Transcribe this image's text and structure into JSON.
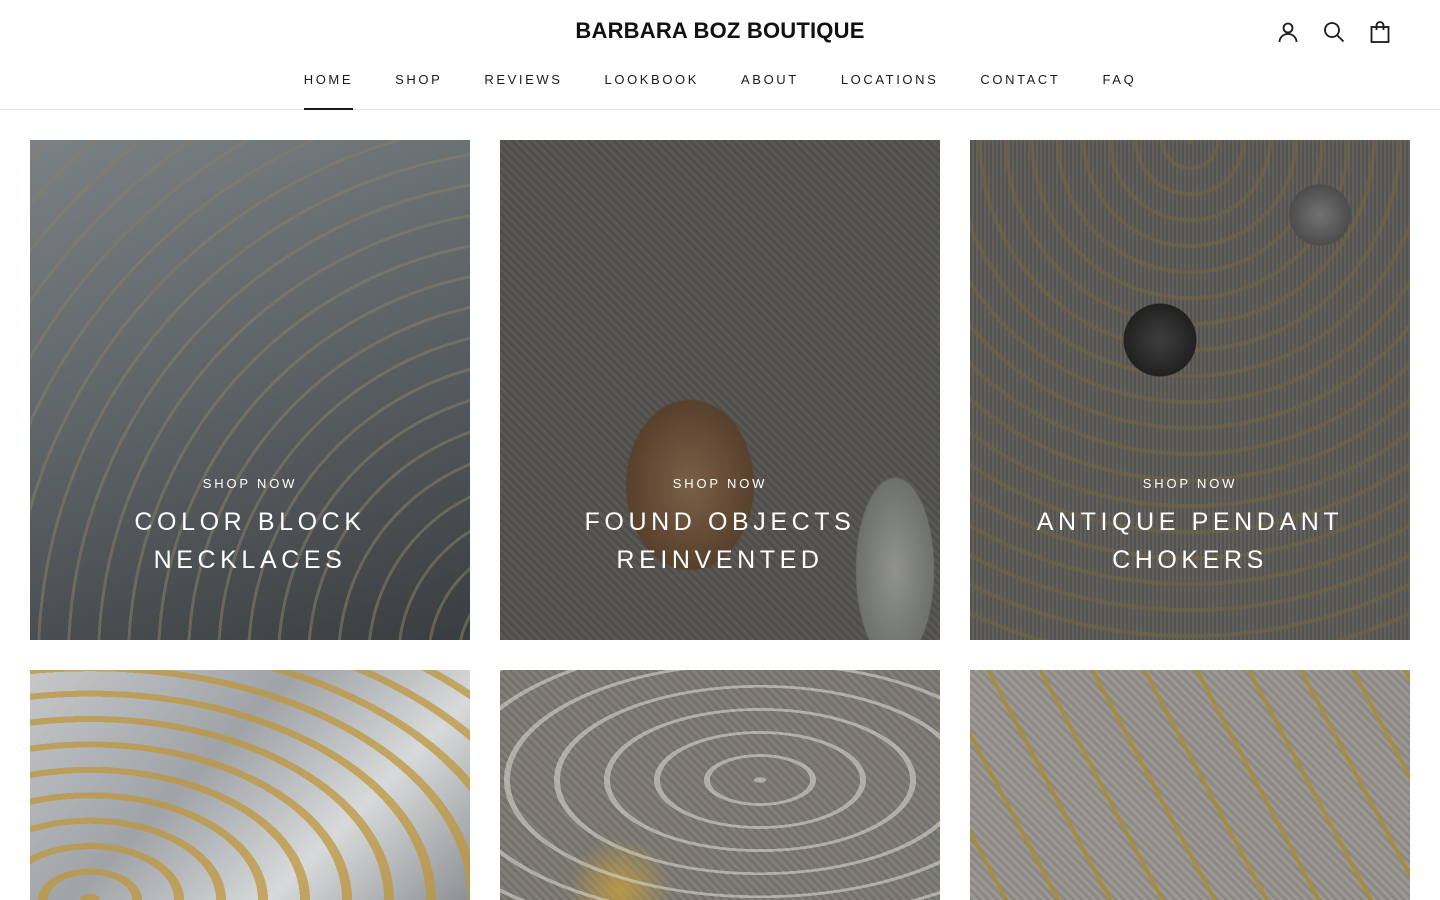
{
  "header": {
    "logo": "BARBARA BOZ BOUTIQUE",
    "icons": [
      "account-icon",
      "search-icon",
      "cart-icon"
    ]
  },
  "nav": {
    "items": [
      {
        "label": "HOME",
        "active": true
      },
      {
        "label": "SHOP",
        "active": false
      },
      {
        "label": "REVIEWS",
        "active": false
      },
      {
        "label": "LOOKBOOK",
        "active": false
      },
      {
        "label": "ABOUT",
        "active": false
      },
      {
        "label": "LOCATIONS",
        "active": false
      },
      {
        "label": "CONTACT",
        "active": false
      },
      {
        "label": "FAQ",
        "active": false
      }
    ]
  },
  "collections": [
    {
      "cta": "SHOP NOW",
      "title": "COLOR BLOCK NECKLACES"
    },
    {
      "cta": "SHOP NOW",
      "title": "FOUND OBJECTS REINVENTED"
    },
    {
      "cta": "SHOP NOW",
      "title": "ANTIQUE PENDANT CHOKERS"
    }
  ],
  "colors": {
    "text": "#1c1b1b",
    "overlay_text": "#ffffff",
    "border": "#e1e1e1"
  }
}
